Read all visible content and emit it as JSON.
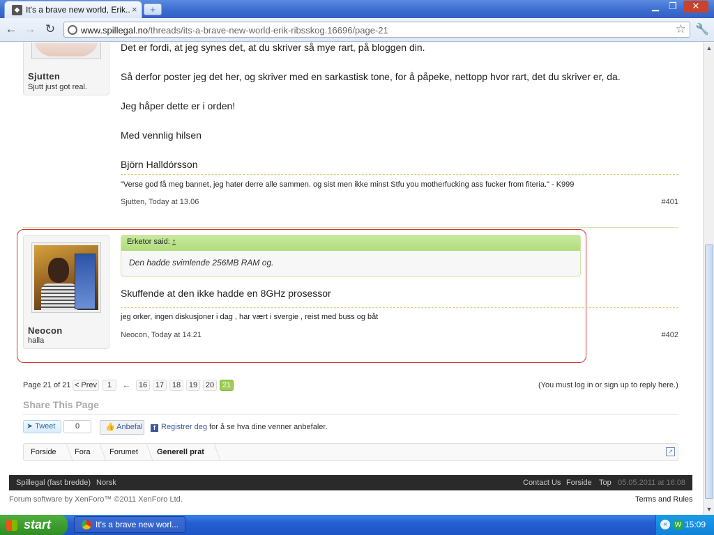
{
  "browser": {
    "tab_title": "It's a brave new world, Erik...",
    "tab_close": "×",
    "new_tab": "+",
    "url_host": "www.spillegal.no",
    "url_path": "/threads/its-a-brave-new-world-erik-ribsskog.16696/page-21",
    "controls": {
      "minimize": "▁",
      "restore": "❐",
      "close": "✕"
    }
  },
  "post401": {
    "username": "Sjutten",
    "user_title": "Sjutt just got real.",
    "lines": [
      "Det er fordi, at jeg synes det, at du skriver så mye rart, på bloggen din.",
      "Så derfor poster jeg det her, og skriver med en sarkastisk tone, for å påpeke, nettopp hvor rart, det du skriver er, da.",
      "Jeg håper dette er i orden!",
      "Med vennlig hilsen",
      "Björn Halldórsson"
    ],
    "signature": "\"Verse god få meg bannet, jeg hater derre alle sammen. og sist men ikke minst Stfu you motherfucking ass fucker from fiteria.\" - K999",
    "meta": "Sjutten, Today at 13.06",
    "number": "#401"
  },
  "post402": {
    "username": "Neocon",
    "user_title": "halla",
    "quote_author": "Erketor said:",
    "quote_arrow": "↑",
    "quote_text": "Den hadde svimlende 256MB RAM og.",
    "message": "Skuffende at den ikke hadde en 8GHz prosessor",
    "signature": "jeg orker, ingen diskusjoner i dag , har vært i svergie , reist med buss og båt",
    "meta": "Neocon, Today at 14.21",
    "number": "#402"
  },
  "pagination": {
    "label": "Page 21 of 21",
    "prev": "< Prev",
    "first": "1",
    "skip": "←",
    "pages": [
      "16",
      "17",
      "18",
      "19",
      "20",
      "21"
    ],
    "current": "21",
    "reply_notice": "(You must log in or sign up to reply here.)"
  },
  "share": {
    "heading": "Share This Page",
    "tweet": "Tweet",
    "tweet_count": "0",
    "like": "Anbefal",
    "fb_link": "Registrer deg",
    "fb_text": "for å se hva dine venner anbefaler."
  },
  "breadcrumb": [
    "Forside",
    "Fora",
    "Forumet",
    "Generell prat"
  ],
  "footer": {
    "style": "Spillegal (fast bredde)",
    "language": "Norsk",
    "contact": "Contact Us",
    "home": "Forside",
    "top": "Top",
    "timestamp": "05.05.2011 at 16:08",
    "copyright": "Forum software by XenForo™ ©2011 XenForo Ltd.",
    "terms": "Terms and Rules"
  },
  "taskbar": {
    "start": "start",
    "item": "It's a brave new worl...",
    "time": "15:09"
  }
}
